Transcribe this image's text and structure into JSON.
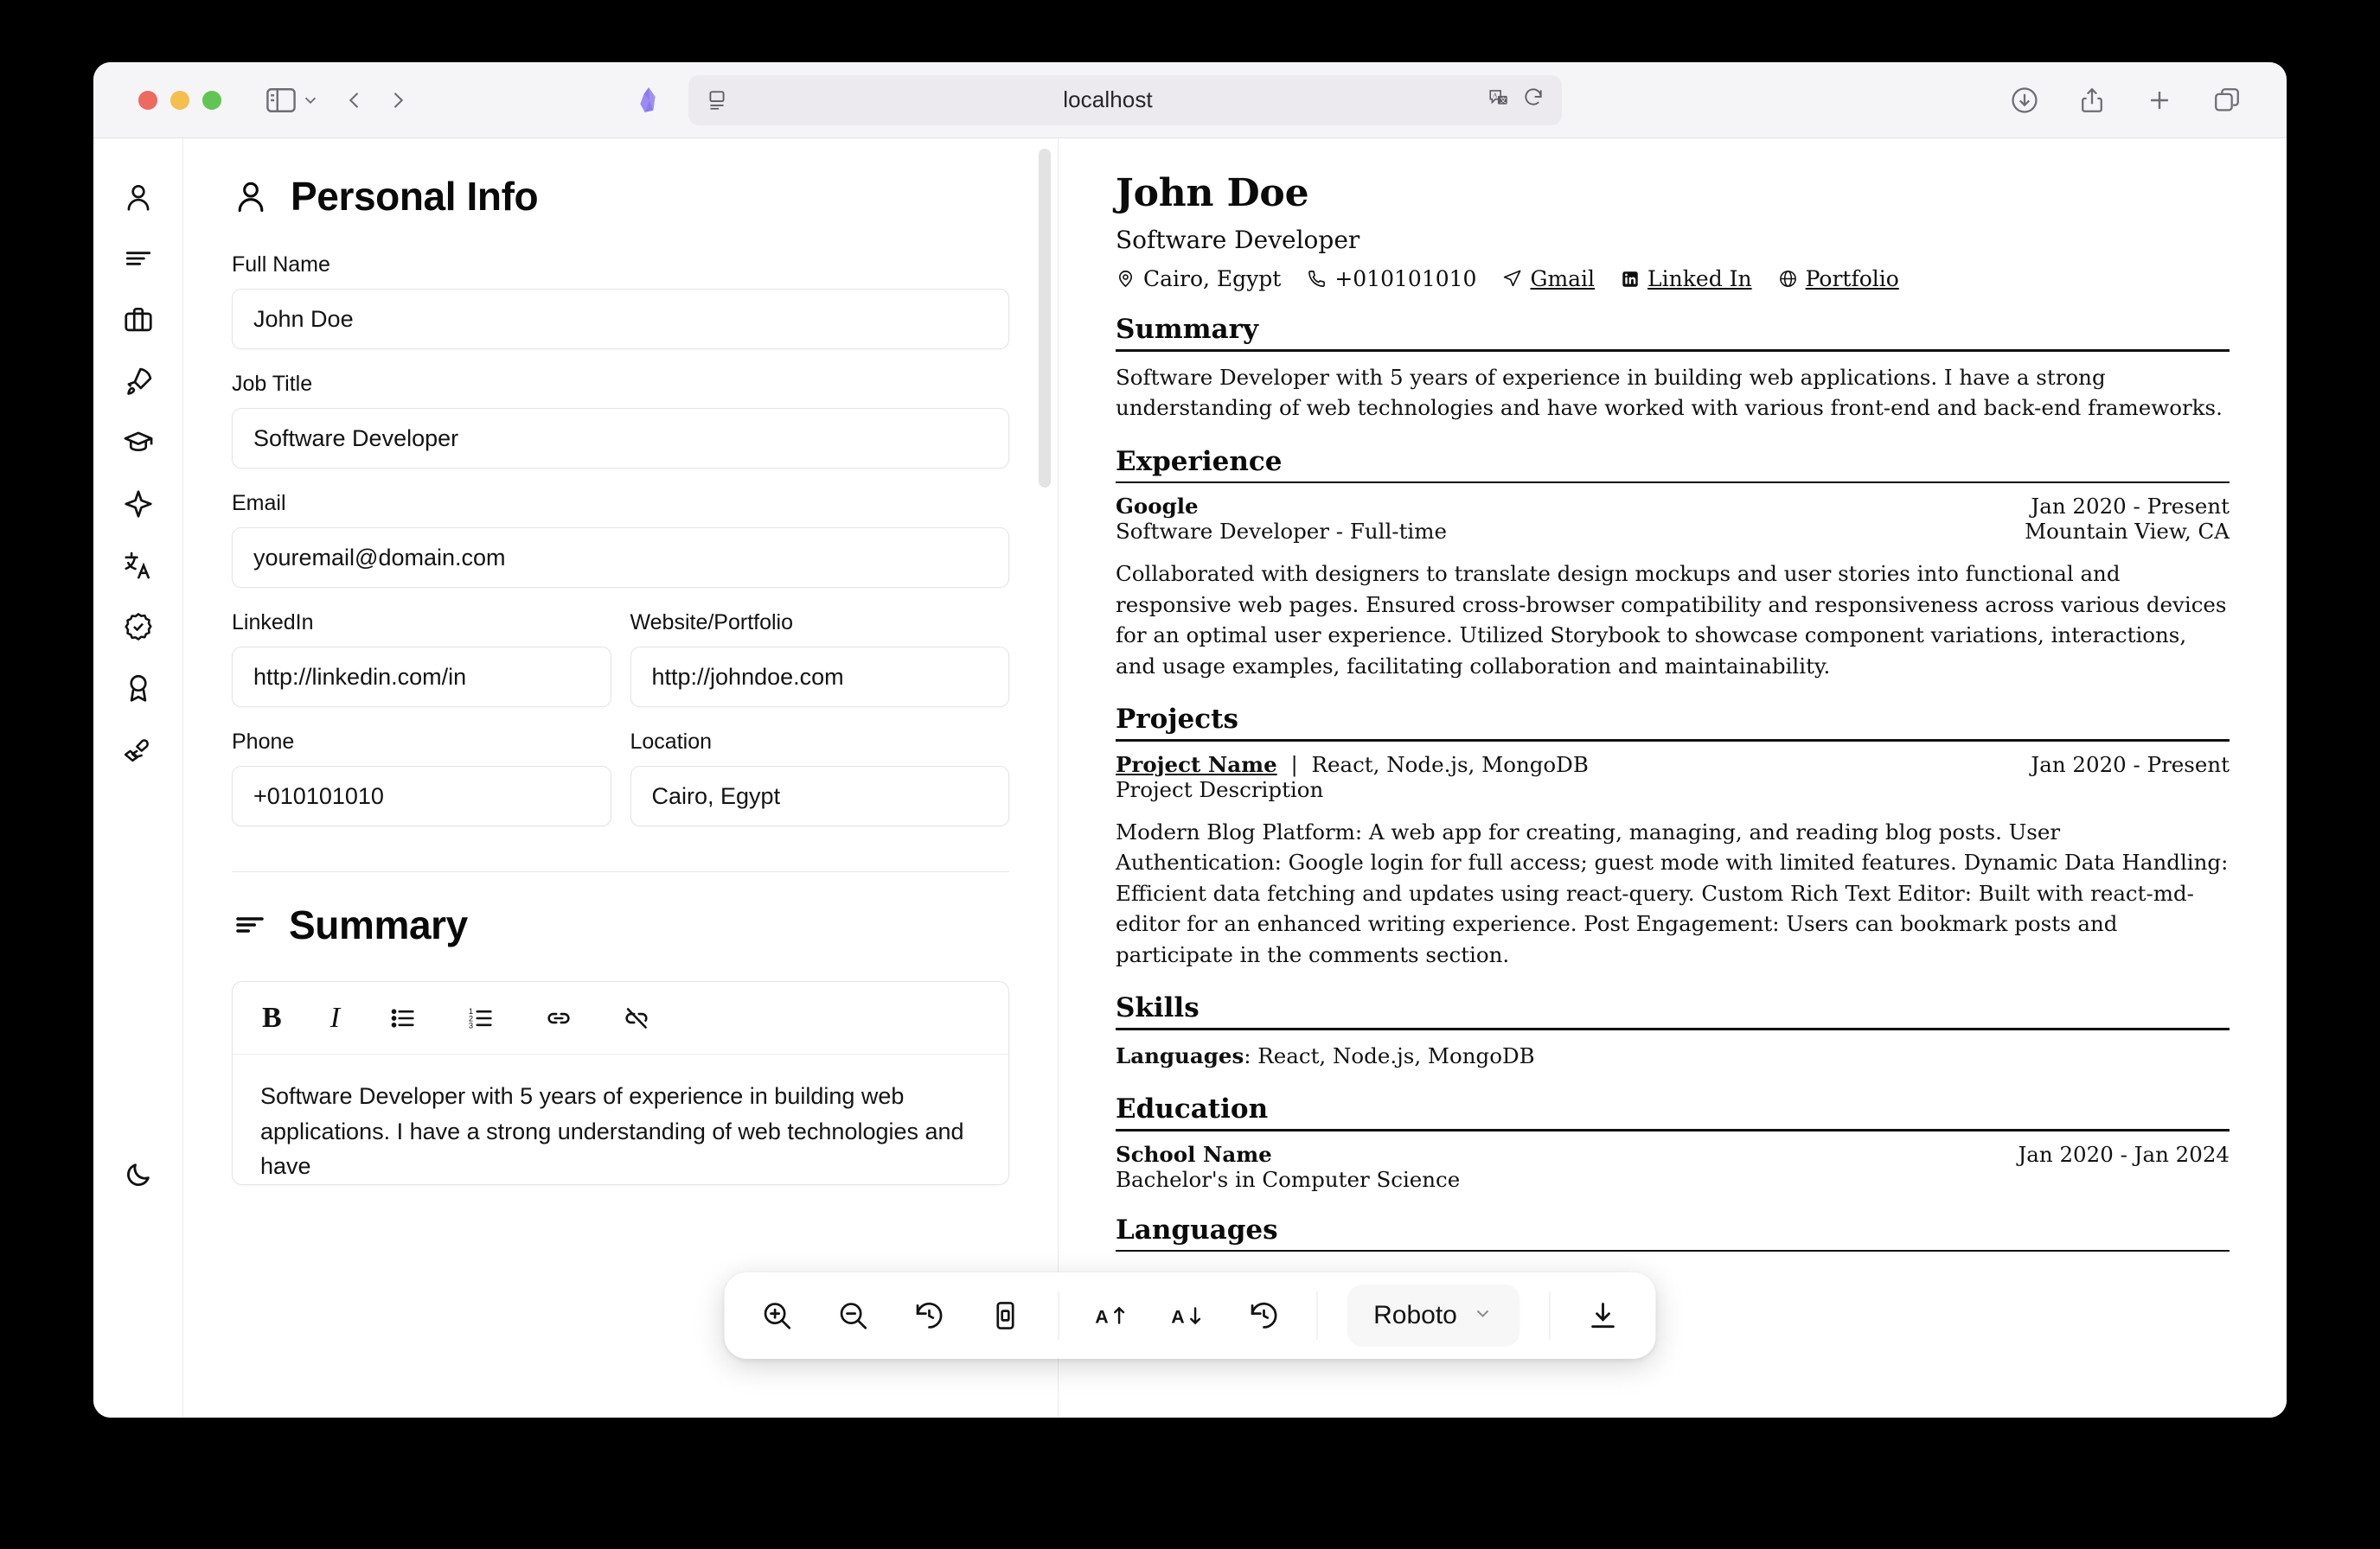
{
  "browser": {
    "url": "localhost",
    "traffic_lights": [
      "close",
      "minimize",
      "maximize"
    ],
    "icons": {
      "sidebar_toggle": "sidebar-toggle-icon",
      "sidebar_chevron": "chevron-down-icon",
      "back": "chevron-left-icon",
      "forward": "chevron-right-icon",
      "favicon": "gem-logo-icon",
      "reader": "reader-view-icon",
      "translate": "translate-icon",
      "reload": "reload-icon",
      "downloads": "download-circle-icon",
      "share": "share-icon",
      "new_tab": "plus-icon",
      "tab_overview": "tab-overview-icon"
    }
  },
  "rail": {
    "items": [
      {
        "name": "personal-info",
        "icon": "user-icon"
      },
      {
        "name": "summary",
        "icon": "align-left-icon"
      },
      {
        "name": "experience",
        "icon": "briefcase-icon"
      },
      {
        "name": "projects",
        "icon": "rocket-icon"
      },
      {
        "name": "education",
        "icon": "graduation-cap-icon"
      },
      {
        "name": "skills",
        "icon": "sparkle-icon"
      },
      {
        "name": "languages",
        "icon": "translate-icon"
      },
      {
        "name": "certifications",
        "icon": "badge-check-icon"
      },
      {
        "name": "awards",
        "icon": "award-icon"
      },
      {
        "name": "volunteering",
        "icon": "heart-hand-icon"
      }
    ],
    "theme_toggle": {
      "name": "dark-mode-toggle",
      "icon": "moon-icon"
    }
  },
  "form": {
    "section_title": "Personal Info",
    "section_icon": "user-icon",
    "fields": {
      "full_name": {
        "label": "Full Name",
        "value": "John Doe"
      },
      "job_title": {
        "label": "Job Title",
        "value": "Software Developer"
      },
      "email": {
        "label": "Email",
        "value": "youremail@domain.com"
      },
      "linkedin": {
        "label": "LinkedIn",
        "value": "http://linkedin.com/in"
      },
      "website": {
        "label": "Website/Portfolio",
        "value": "http://johndoe.com"
      },
      "phone": {
        "label": "Phone",
        "value": "+010101010"
      },
      "location": {
        "label": "Location",
        "value": "Cairo, Egypt"
      }
    },
    "summary": {
      "section_title": "Summary",
      "section_icon": "align-left-icon",
      "toolbar": [
        {
          "name": "bold-button",
          "label": "B"
        },
        {
          "name": "italic-button",
          "label": "I"
        },
        {
          "name": "bullet-list-button",
          "label": "bullet-list-icon"
        },
        {
          "name": "ordered-list-button",
          "label": "ordered-list-icon"
        },
        {
          "name": "link-button",
          "label": "link-icon"
        },
        {
          "name": "unlink-button",
          "label": "unlink-icon"
        }
      ],
      "text": "Software Developer with 5 years of experience in building web applications. I have a strong understanding of web technologies and have"
    }
  },
  "resume": {
    "name": "John Doe",
    "role": "Software Developer",
    "contact": {
      "location": "Cairo, Egypt",
      "phone": "+010101010",
      "email_label": "Gmail",
      "linkedin_label": "Linked In",
      "portfolio_label": "Portfolio"
    },
    "sections": {
      "summary": {
        "title": "Summary",
        "text": "Software Developer with 5 years of experience in building web applications. I have a strong understanding of web technologies and have worked with various front-end and back-end frameworks."
      },
      "experience": {
        "title": "Experience",
        "company": "Google",
        "dates": "Jan 2020 - Present",
        "position": "Software Developer - Full-time",
        "location": "Mountain View, CA",
        "description": "Collaborated with designers to translate design mockups and user stories into functional and responsive web pages. Ensured cross-browser compatibility and responsiveness across various devices for an optimal user experience. Utilized Storybook to showcase component variations, interactions, and usage examples, facilitating collaboration and maintainability."
      },
      "projects": {
        "title": "Projects",
        "project_name": "Project Name",
        "separator": "|",
        "stack": "React, Node.js, MongoDB",
        "dates": "Jan 2020 - Present",
        "subtitle": "Project Description",
        "description": "Modern Blog Platform: A web app for creating, managing, and reading blog posts. User Authentication: Google login for full access; guest mode with limited features. Dynamic Data Handling: Efficient data fetching and updates using react-query. Custom Rich Text Editor: Built with react-md-editor for an enhanced writing experience. Post Engagement: Users can bookmark posts and participate in the comments section."
      },
      "skills": {
        "title": "Skills",
        "category": "Languages",
        "items": "React, Node.js, MongoDB"
      },
      "education": {
        "title": "Education",
        "school": "School Name",
        "dates": "Jan 2020 - Jan 2024",
        "degree": "Bachelor's in Computer Science"
      },
      "languages": {
        "title": "Languages"
      }
    }
  },
  "float_toolbar": {
    "buttons": [
      {
        "name": "zoom-in-button",
        "icon": "zoom-in-icon"
      },
      {
        "name": "zoom-out-button",
        "icon": "zoom-out-icon"
      },
      {
        "name": "reset-zoom-button",
        "icon": "history-icon"
      },
      {
        "name": "fit-page-button",
        "icon": "fit-page-icon"
      },
      {
        "name": "increase-font-button",
        "icon": "font-up-icon"
      },
      {
        "name": "decrease-font-button",
        "icon": "font-down-icon"
      },
      {
        "name": "reset-font-button",
        "icon": "history-icon"
      },
      {
        "name": "download-button",
        "icon": "download-icon"
      }
    ],
    "font_family": "Roboto",
    "font_chevron": "chevron-down-icon"
  }
}
